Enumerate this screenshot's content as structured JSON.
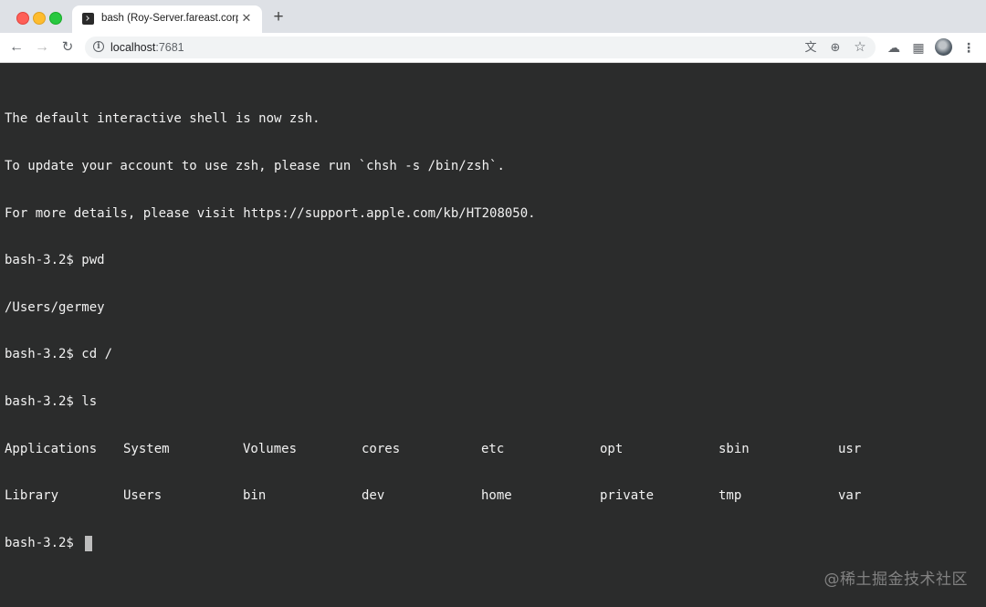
{
  "browser": {
    "tab": {
      "title": "bash (Roy-Server.fareast.corp",
      "close_glyph": "✕",
      "icon": "terminal-icon"
    },
    "new_tab_glyph": "+",
    "url": {
      "host": "localhost",
      "port": ":7681"
    },
    "icons": [
      "back-icon",
      "forward-icon",
      "reload-icon",
      "info-icon",
      "translate-icon",
      "zoom-icon",
      "star-icon",
      "cloud-icon",
      "puzzle-icon",
      "avatar",
      "menu-icon"
    ]
  },
  "terminal": {
    "lines": [
      "The default interactive shell is now zsh.",
      "To update your account to use zsh, please run `chsh -s /bin/zsh`.",
      "For more details, please visit https://support.apple.com/kb/HT208050.",
      "bash-3.2$ pwd",
      "/Users/germey",
      "bash-3.2$ cd /",
      "bash-3.2$ ls"
    ],
    "ls_rows": [
      [
        "Applications",
        "System",
        "Volumes",
        "cores",
        "etc",
        "opt",
        "sbin",
        "usr"
      ],
      [
        "Library",
        "Users",
        "bin",
        "dev",
        "home",
        "private",
        "tmp",
        "var"
      ]
    ],
    "prompt": "bash-3.2$ "
  },
  "watermark": "@稀土掘金技术社区"
}
